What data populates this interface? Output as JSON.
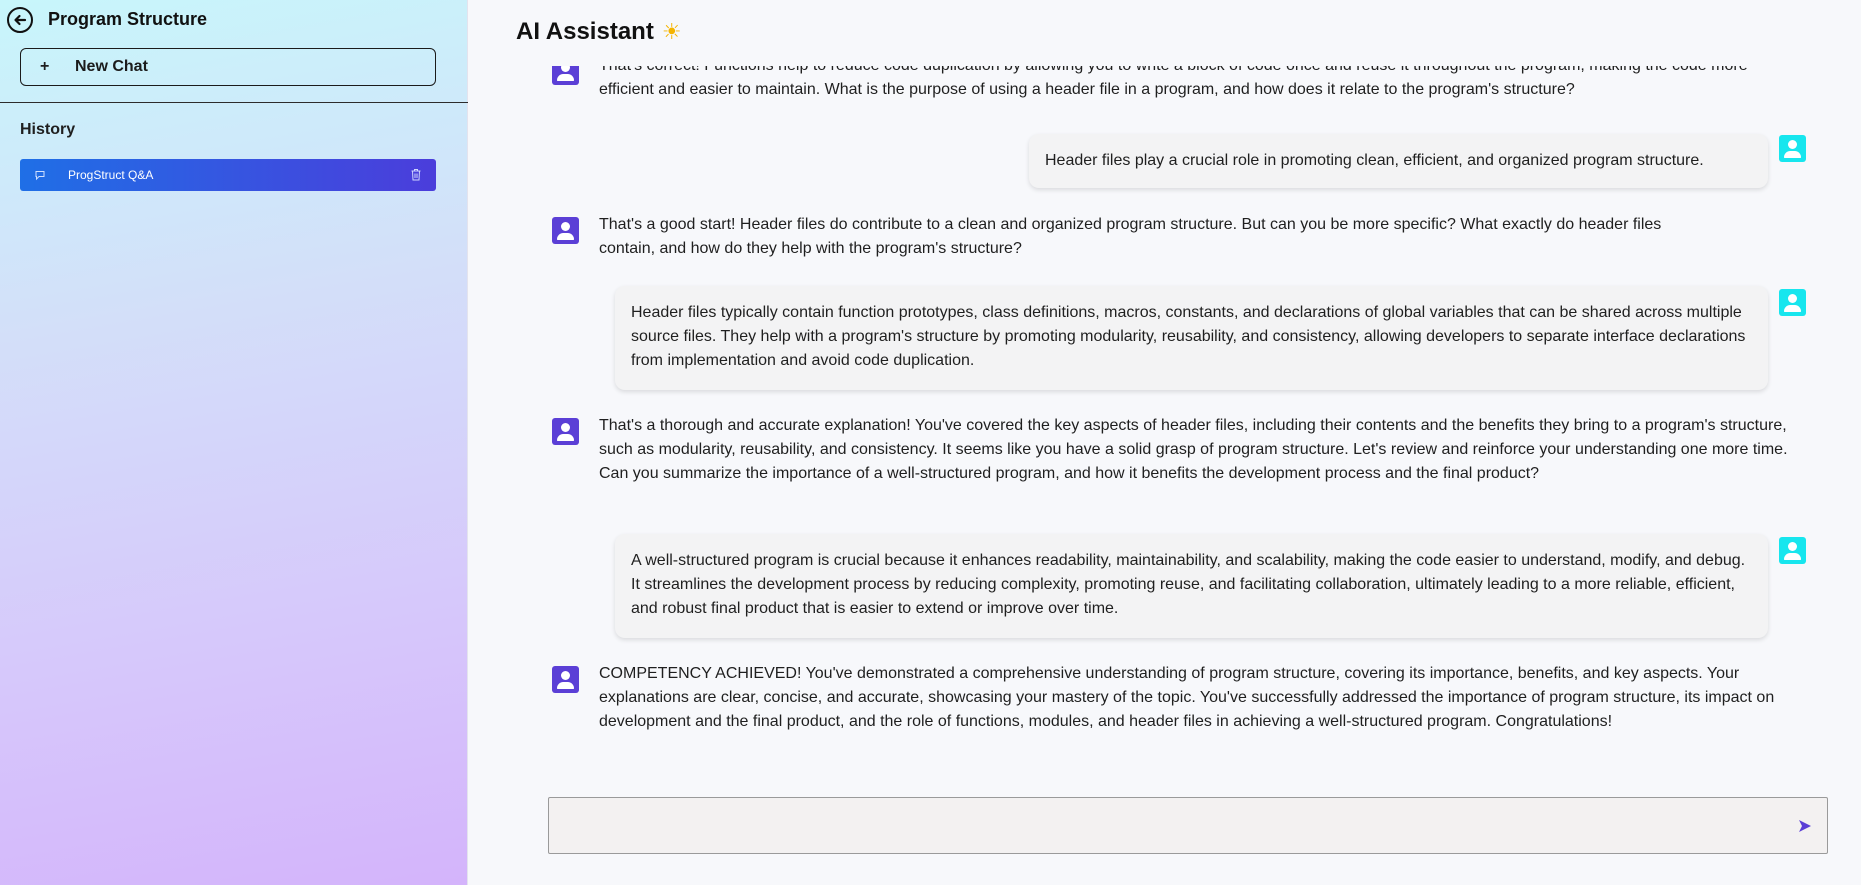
{
  "sidebar": {
    "title": "Program Structure",
    "new_chat": {
      "icon": "+",
      "label": "New Chat"
    },
    "history_heading": "History",
    "history_items": [
      {
        "label": "ProgStruct Q&A"
      }
    ]
  },
  "main": {
    "title": "AI Assistant",
    "title_icon": "☀",
    "messages": [
      {
        "role": "assistant",
        "text": "That's correct! Functions help to reduce code duplication by allowing you to write a block of code once and reuse it throughout the program, making the code more efficient and easier to maintain. What is the purpose of using a header file in a program, and how does it relate to the program's structure?"
      },
      {
        "role": "user",
        "text": "Header files play a crucial role in promoting clean, efficient, and organized program structure."
      },
      {
        "role": "assistant",
        "text": "That's a good start! Header files do contribute to a clean and organized program structure. But can you be more specific? What exactly do header files contain, and how do they help with the program's structure?"
      },
      {
        "role": "user",
        "text": "Header files typically contain function prototypes, class definitions, macros, constants, and declarations of global variables that can be shared across multiple source files. They help with a program's structure by promoting modularity, reusability, and consistency, allowing developers to separate interface declarations from implementation and avoid code duplication."
      },
      {
        "role": "assistant",
        "text": "That's a thorough and accurate explanation! You've covered the key aspects of header files, including their contents and the benefits they bring to a program's structure, such as modularity, reusability, and consistency. It seems like you have a solid grasp of program structure. Let's review and reinforce your understanding one more time. Can you summarize the importance of a well-structured program, and how it benefits the development process and the final product?"
      },
      {
        "role": "user",
        "text": "A well-structured program is crucial because it enhances readability, maintainability, and scalability, making the code easier to understand, modify, and debug. It streamlines the development process by reducing complexity, promoting reuse, and facilitating collaboration, ultimately leading to a more reliable, efficient, and robust final product that is easier to extend or improve over time."
      },
      {
        "role": "assistant",
        "text": "COMPETENCY ACHIEVED! You've demonstrated a comprehensive understanding of program structure, covering its importance, benefits, and key aspects. Your explanations are clear, concise, and accurate, showcasing your mastery of the topic. You've successfully addressed the importance of program structure, its impact on development and the final product, and the role of functions, modules, and header files in achieving a well-structured program. Congratulations!"
      }
    ]
  },
  "composer": {
    "value": "",
    "placeholder": ""
  },
  "colors": {
    "accent": "#5b3fd6",
    "user_avatar": "#17e6ee",
    "history_active_start": "#1f6fe6",
    "history_active_end": "#4b3ddb"
  },
  "icons": {
    "back": "back-arrow-icon",
    "send": "send-icon",
    "delete": "trash-icon",
    "chat": "chat-bubble-icon"
  }
}
